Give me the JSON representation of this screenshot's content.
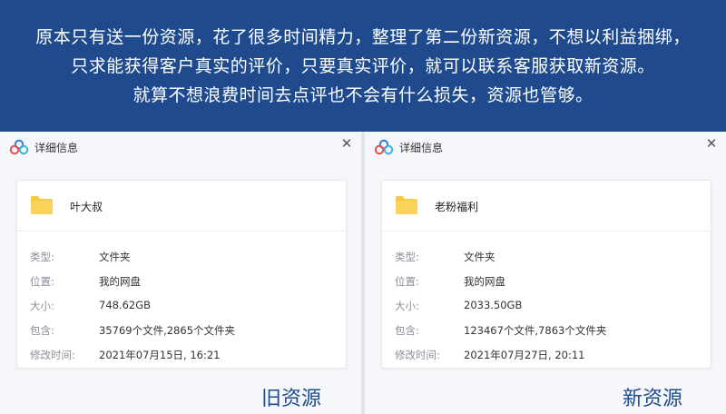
{
  "banner": {
    "lines": [
      "原本只有送一份资源，花了很多时间精力，整理了第二份新资源，不想以利益捆绑，",
      "只求能获得客户真实的评价，只要真实评价，就可以联系客服获取新资源。",
      "就算不想浪费时间去点评也不会有什么损失，资源也管够。"
    ],
    "background": "#1f4b8e"
  },
  "panels": [
    {
      "title": "详细信息",
      "close_glyph": "✕",
      "folder_name": "叶大叔",
      "rows": [
        {
          "label": "类型:",
          "value": "文件夹"
        },
        {
          "label": "位置:",
          "value": "我的网盘"
        },
        {
          "label": "大小:",
          "value": "748.62GB"
        },
        {
          "label": "包含:",
          "value": "35769个文件,2865个文件夹"
        },
        {
          "label": "修改时间:",
          "value": "2021年07月15日, 16:21"
        }
      ],
      "caption": "旧资源"
    },
    {
      "title": "详细信息",
      "close_glyph": "✕",
      "folder_name": "老粉福利",
      "rows": [
        {
          "label": "类型:",
          "value": "文件夹"
        },
        {
          "label": "位置:",
          "value": "我的网盘"
        },
        {
          "label": "大小:",
          "value": "2033.50GB"
        },
        {
          "label": "包含:",
          "value": "123467个文件,7863个文件夹"
        },
        {
          "label": "修改时间:",
          "value": "2021年07月27日, 20:11"
        }
      ],
      "caption": "新资源"
    }
  ],
  "icons": {
    "app": "cloud-logo-icon",
    "folder": "folder-icon",
    "close": "close-icon"
  },
  "colors": {
    "accent": "#1f4b8e",
    "folder": "#f7c845"
  }
}
